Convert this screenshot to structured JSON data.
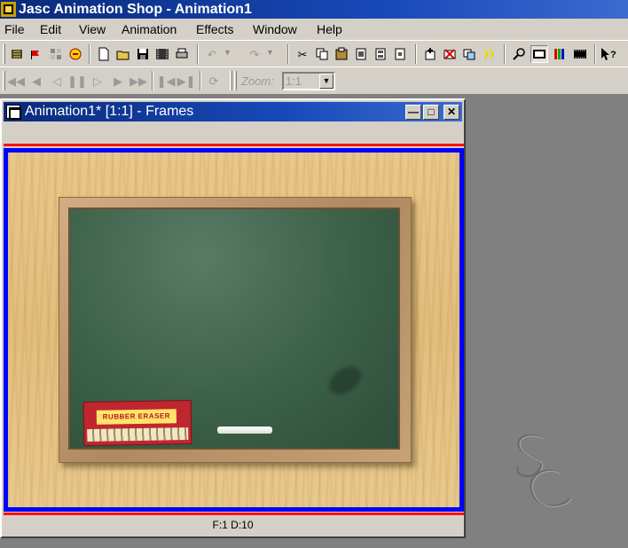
{
  "app": {
    "title": "Jasc Animation Shop - Animation1"
  },
  "menu": [
    "File",
    "Edit",
    "View",
    "Animation",
    "Effects",
    "Window",
    "Help"
  ],
  "toolbar2": {
    "zoom_label": "Zoom:",
    "zoom_value": "1:1"
  },
  "child_window": {
    "title": "Animation1* [1:1] - Frames",
    "status": "F:1   D:10"
  },
  "frame": {
    "eraser_label": "RUBBER ERASER"
  },
  "colors": {
    "selection_border": "#0000ff",
    "frame_divider": "#ff1010",
    "titlebar": "#0a2a7a",
    "workspace": "#808080"
  }
}
